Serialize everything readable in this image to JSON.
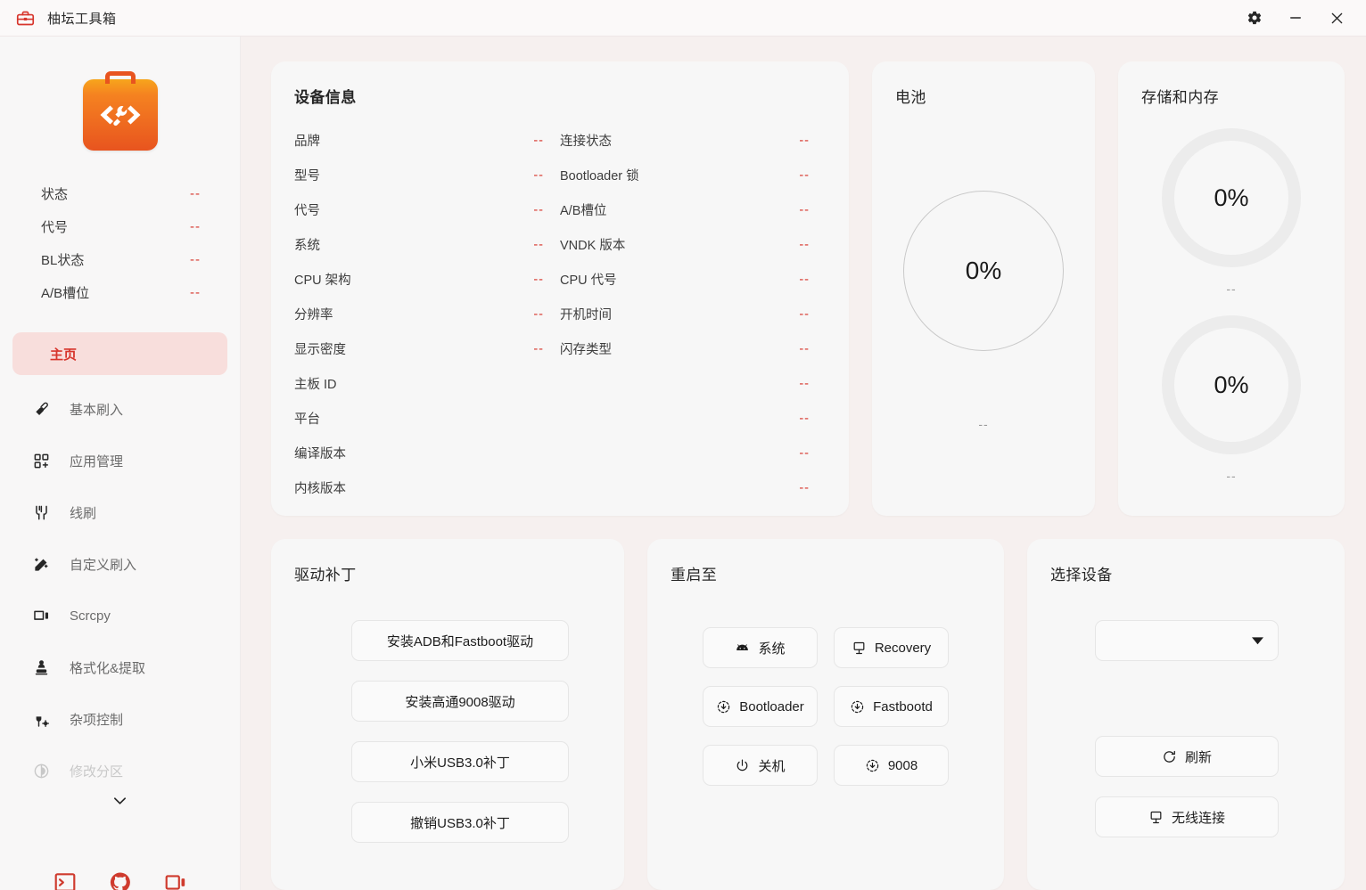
{
  "titlebar": {
    "app_title": "柚坛工具箱",
    "logo_icon": "toolbox-icon",
    "settings_icon": "gear-icon",
    "minimize_icon": "minimize-icon",
    "close_icon": "close-icon"
  },
  "sidebar": {
    "logo_icon": "toolbox-logo",
    "status": [
      {
        "label": "状态",
        "value": "--"
      },
      {
        "label": "代号",
        "value": "--"
      },
      {
        "label": "BL状态",
        "value": "--"
      },
      {
        "label": "A/B槽位",
        "value": "--"
      }
    ],
    "nav": [
      {
        "label": "主页",
        "icon": "",
        "active": true
      },
      {
        "label": "基本刷入",
        "icon": "flash-icon"
      },
      {
        "label": "应用管理",
        "icon": "apps-icon"
      },
      {
        "label": "线刷",
        "icon": "cable-icon"
      },
      {
        "label": "自定义刷入",
        "icon": "magic-wand-icon"
      },
      {
        "label": "Scrcpy",
        "icon": "screen-mirror-icon"
      },
      {
        "label": "格式化&提取",
        "icon": "extract-icon"
      },
      {
        "label": "杂项控制",
        "icon": "wrench-settings-icon"
      },
      {
        "label": "修改分区",
        "icon": "partition-icon",
        "faded": true
      }
    ],
    "scroll_chevron_icon": "chevron-down-icon",
    "footer_icons": [
      "terminal-icon",
      "github-icon",
      "screen-icon"
    ]
  },
  "device_info": {
    "title": "设备信息",
    "rows": [
      {
        "left": {
          "label": "品牌",
          "value": "--"
        },
        "right": {
          "label": "连接状态",
          "value": "--"
        }
      },
      {
        "left": {
          "label": "型号",
          "value": "--"
        },
        "right": {
          "label": "Bootloader 锁",
          "value": "--"
        }
      },
      {
        "left": {
          "label": "代号",
          "value": "--"
        },
        "right": {
          "label": "A/B槽位",
          "value": "--"
        }
      },
      {
        "left": {
          "label": "系统",
          "value": "--"
        },
        "right": {
          "label": "VNDK 版本",
          "value": "--"
        }
      },
      {
        "left": {
          "label": "CPU 架构",
          "value": "--"
        },
        "right": {
          "label": "CPU 代号",
          "value": "--"
        }
      },
      {
        "left": {
          "label": "分辨率",
          "value": "--"
        },
        "right": {
          "label": "开机时间",
          "value": "--"
        }
      },
      {
        "left": {
          "label": "显示密度",
          "value": "--"
        },
        "right": {
          "label": "闪存类型",
          "value": "--"
        }
      }
    ],
    "full_rows": [
      {
        "label": "主板 ID",
        "value": "--"
      },
      {
        "label": "平台",
        "value": "--"
      },
      {
        "label": "编译版本",
        "value": "--"
      },
      {
        "label": "内核版本",
        "value": "--"
      }
    ]
  },
  "battery": {
    "title": "电池",
    "percent": "0%",
    "caption": "--"
  },
  "storage": {
    "title": "存储和内存",
    "gauges": [
      {
        "percent": "0%",
        "caption": "--"
      },
      {
        "percent": "0%",
        "caption": "--"
      }
    ]
  },
  "driver_patch": {
    "title": "驱动补丁",
    "buttons": [
      {
        "label": "安装ADB和Fastboot驱动"
      },
      {
        "label": "安装高通9008驱动"
      },
      {
        "label": "小米USB3.0补丁"
      },
      {
        "label": "撤销USB3.0补丁"
      }
    ]
  },
  "reboot_to": {
    "title": "重启至",
    "buttons": [
      {
        "label": "系统",
        "icon": "android-icon"
      },
      {
        "label": "Recovery",
        "icon": "monitor-icon"
      },
      {
        "label": "Bootloader",
        "icon": "download-circle-icon"
      },
      {
        "label": "Fastbootd",
        "icon": "download-circle-icon"
      },
      {
        "label": "关机",
        "icon": "power-icon"
      },
      {
        "label": "9008",
        "icon": "download-circle-icon"
      }
    ]
  },
  "select_device": {
    "title": "选择设备",
    "dropdown_value": "",
    "dropdown_caret_icon": "caret-down-icon",
    "refresh_label": "刷新",
    "refresh_icon": "refresh-icon",
    "wireless_label": "无线连接",
    "wireless_icon": "monitor-icon"
  },
  "colors": {
    "accent": "#d7352c",
    "accent_bg": "#f8dedc",
    "page_bg": "#f6f0ef",
    "card_bg": "#f7f7f7",
    "sidebar_bg": "#f8f7f7"
  }
}
